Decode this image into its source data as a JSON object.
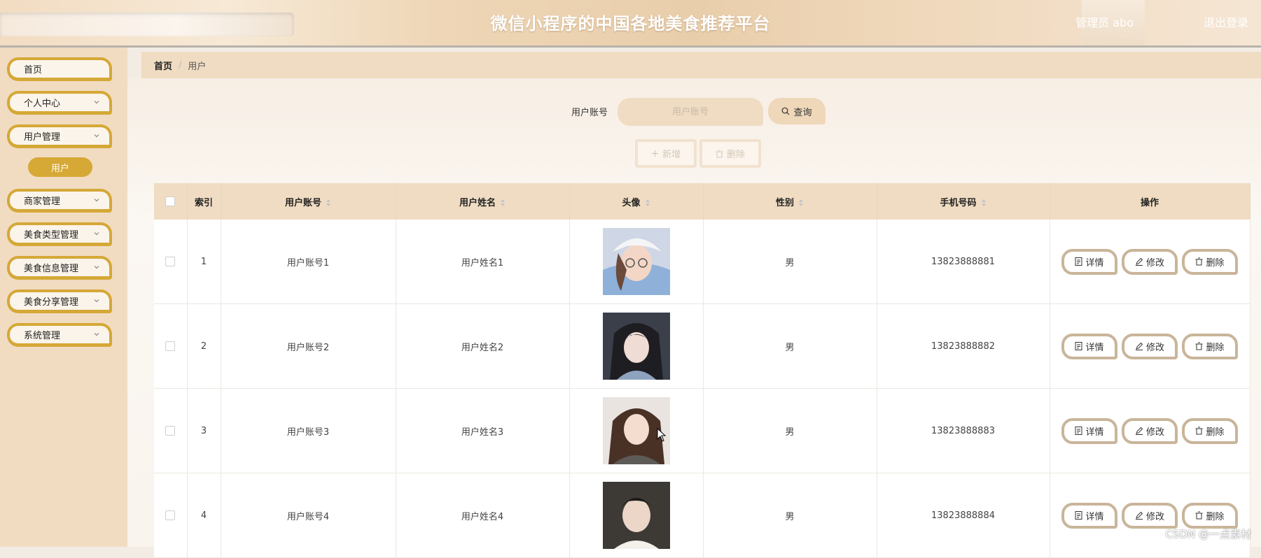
{
  "header": {
    "title": "微信小程序的中国各地美食推荐平台",
    "user_label": "管理员 abo",
    "logout_label": "退出登录"
  },
  "sidebar": {
    "items": [
      {
        "label": "首页"
      },
      {
        "label": "个人中心"
      },
      {
        "label": "用户管理"
      },
      {
        "label": "商家管理"
      },
      {
        "label": "美食类型管理"
      },
      {
        "label": "美食信息管理"
      },
      {
        "label": "美食分享管理"
      },
      {
        "label": "系统管理"
      }
    ],
    "active_sub_label": "用户"
  },
  "breadcrumb": {
    "home": "首页",
    "separator": "/",
    "current": "用户"
  },
  "search": {
    "label": "用户账号",
    "placeholder": "用户账号",
    "button_label": "查询"
  },
  "actions": {
    "add_label": "新增",
    "delete_label": "删除"
  },
  "table": {
    "columns": [
      "索引",
      "用户账号",
      "用户姓名",
      "头像",
      "性别",
      "手机号码",
      "操作"
    ],
    "rows": [
      {
        "index": "1",
        "account": "用户账号1",
        "name": "用户姓名1",
        "gender": "男",
        "phone": "13823888881"
      },
      {
        "index": "2",
        "account": "用户账号2",
        "name": "用户姓名2",
        "gender": "男",
        "phone": "13823888882"
      },
      {
        "index": "3",
        "account": "用户账号3",
        "name": "用户姓名3",
        "gender": "男",
        "phone": "13823888883"
      },
      {
        "index": "4",
        "account": "用户账号4",
        "name": "用户姓名4",
        "gender": "男",
        "phone": "13823888884"
      }
    ],
    "op_labels": {
      "detail": "详情",
      "edit": "修改",
      "delete": "删除"
    }
  },
  "watermark": "CSDN @一点素材",
  "colors": {
    "accent": "#d6a936",
    "header_bg": "#eed6b6",
    "table_header_bg": "#f0dcc2",
    "op_border": "#c9b59a"
  }
}
